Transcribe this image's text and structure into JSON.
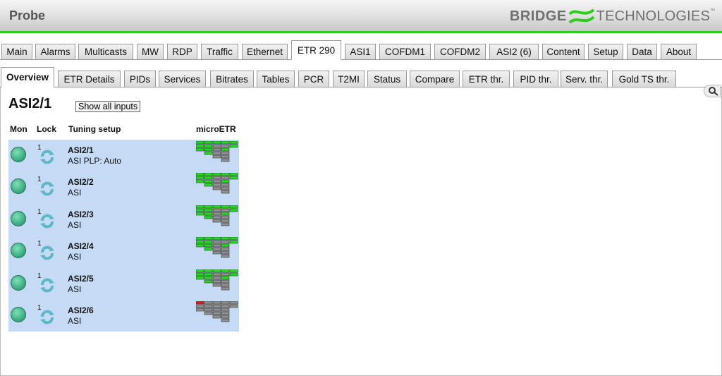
{
  "header": {
    "title": "Probe",
    "logo_bold": "BRIDGE",
    "logo_light": "TECHNOLOGIES",
    "logo_tm": "™"
  },
  "colors": {
    "accent": "#2ecc1f",
    "table_bg": "#c5dbf5",
    "metr_ok": "#22dd22",
    "metr_err": "#d02020",
    "metr_grey": "#909090"
  },
  "main_tabs": [
    {
      "label": "Main"
    },
    {
      "label": "Alarms"
    },
    {
      "label": "Multicasts"
    },
    {
      "label": "MW"
    },
    {
      "label": "RDP"
    },
    {
      "label": "Traffic"
    },
    {
      "label": "Ethernet"
    },
    {
      "label": "ETR 290",
      "active": true
    },
    {
      "label": "ASI1"
    },
    {
      "label": "COFDM1"
    },
    {
      "label": "COFDM2"
    },
    {
      "label": "ASI2 (6)"
    },
    {
      "label": "Content"
    },
    {
      "label": "Setup"
    },
    {
      "label": "Data"
    },
    {
      "label": "About"
    }
  ],
  "sub_tabs": [
    {
      "label": "Overview",
      "active": true
    },
    {
      "label": "ETR Details"
    },
    {
      "label": "PIDs"
    },
    {
      "label": "Services"
    },
    {
      "label": "Bitrates"
    },
    {
      "label": "Tables"
    },
    {
      "label": "PCR"
    },
    {
      "label": "T2MI"
    },
    {
      "label": "Status"
    },
    {
      "label": "Compare"
    },
    {
      "label": "ETR thr."
    },
    {
      "label": "PID thr."
    },
    {
      "label": "Serv. thr."
    },
    {
      "label": "Gold TS thr."
    }
  ],
  "page": {
    "title": "ASI2/1",
    "show_all_button": "Show all inputs"
  },
  "columns": {
    "mon": "Mon",
    "lock": "Lock",
    "tuning": "Tuning setup",
    "metr": "microETR"
  },
  "rows": [
    {
      "lock": "1",
      "name": "ASI2/1",
      "desc": "ASI PLP: Auto",
      "status": "ok"
    },
    {
      "lock": "1",
      "name": "ASI2/2",
      "desc": "ASI",
      "status": "ok"
    },
    {
      "lock": "1",
      "name": "ASI2/3",
      "desc": "ASI",
      "status": "ok"
    },
    {
      "lock": "1",
      "name": "ASI2/4",
      "desc": "ASI",
      "status": "ok"
    },
    {
      "lock": "1",
      "name": "ASI2/5",
      "desc": "ASI",
      "status": "ok"
    },
    {
      "lock": "1",
      "name": "ASI2/6",
      "desc": "ASI",
      "status": "error"
    }
  ]
}
